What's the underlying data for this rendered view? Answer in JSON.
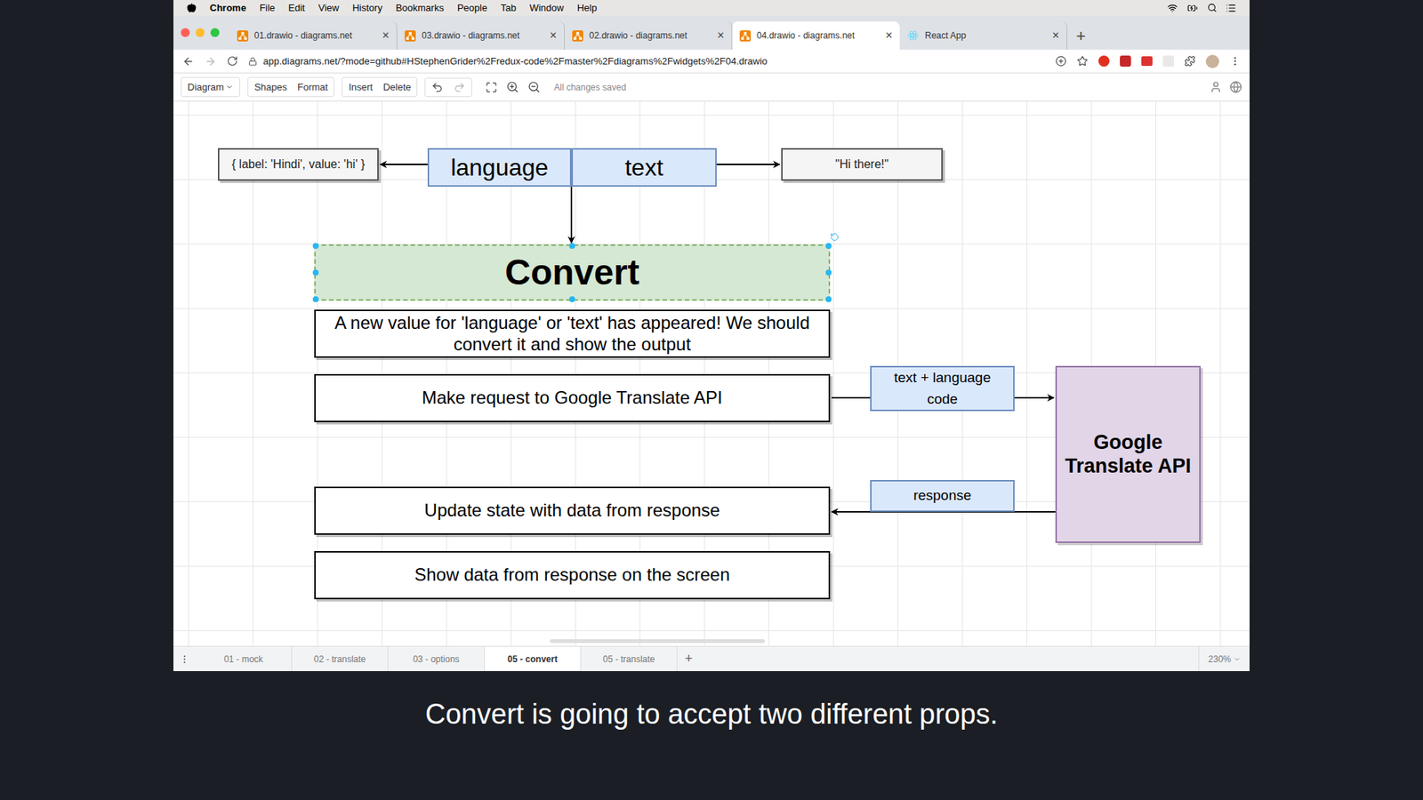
{
  "menubar": {
    "app": "Chrome",
    "items": [
      "File",
      "Edit",
      "View",
      "History",
      "Bookmarks",
      "People",
      "Tab",
      "Window",
      "Help"
    ]
  },
  "browser_tabs": [
    {
      "label": "01.drawio - diagrams.net",
      "kind": "drawio",
      "selected": false,
      "close": "×"
    },
    {
      "label": "03.drawio - diagrams.net",
      "kind": "drawio",
      "selected": false,
      "close": "×"
    },
    {
      "label": "02.drawio - diagrams.net",
      "kind": "drawio",
      "selected": false,
      "close": "×"
    },
    {
      "label": "04.drawio - diagrams.net",
      "kind": "drawio",
      "selected": true,
      "close": "×"
    },
    {
      "label": "React App",
      "kind": "react",
      "selected": false,
      "close": "×"
    }
  ],
  "new_tab": "+",
  "address": {
    "url": "app.diagrams.net/?mode=github#HStephenGrider%2Fredux-code%2Fmaster%2Fdiagrams%2Fwidgets%2F04.drawio"
  },
  "toolbar": {
    "diagram": "Diagram",
    "groups": [
      [
        "Shapes",
        "Format"
      ],
      [
        "Insert",
        "Delete"
      ]
    ],
    "status": "All changes saved"
  },
  "diagram": {
    "nodes": [
      {
        "kind": "value",
        "text": "{ label: 'Hindi', value: 'hi' }",
        "selected": false
      },
      {
        "kind": "prop",
        "text": "language",
        "selected": false
      },
      {
        "kind": "prop",
        "text": "text",
        "selected": false
      },
      {
        "kind": "value",
        "text": "\"Hi there!\"",
        "selected": false
      },
      {
        "kind": "component",
        "text": "Convert",
        "selected": true
      },
      {
        "kind": "step",
        "text": "A new value for 'language' or 'text' has appeared! We should convert it and show the output",
        "selected": false
      },
      {
        "kind": "step",
        "text": "Make request to Google Translate API",
        "selected": false
      },
      {
        "kind": "step",
        "text": "Update state with data from response",
        "selected": false
      },
      {
        "kind": "step",
        "text": "Show data from response on the screen",
        "selected": false
      },
      {
        "kind": "edge-label",
        "text": "text + language code",
        "selected": false
      },
      {
        "kind": "edge-label",
        "text": "response",
        "selected": false
      },
      {
        "kind": "api",
        "text": "Google Translate API",
        "selected": false
      }
    ]
  },
  "pages": [
    {
      "label": "01 - mock",
      "selected": false
    },
    {
      "label": "02 - translate",
      "selected": false
    },
    {
      "label": "03 - options",
      "selected": false
    },
    {
      "label": "05 - convert",
      "selected": true
    },
    {
      "label": "05 - translate",
      "selected": false
    }
  ],
  "add_page": "+",
  "zoom": "230%",
  "subtitle": "Convert is going to accept two different props."
}
